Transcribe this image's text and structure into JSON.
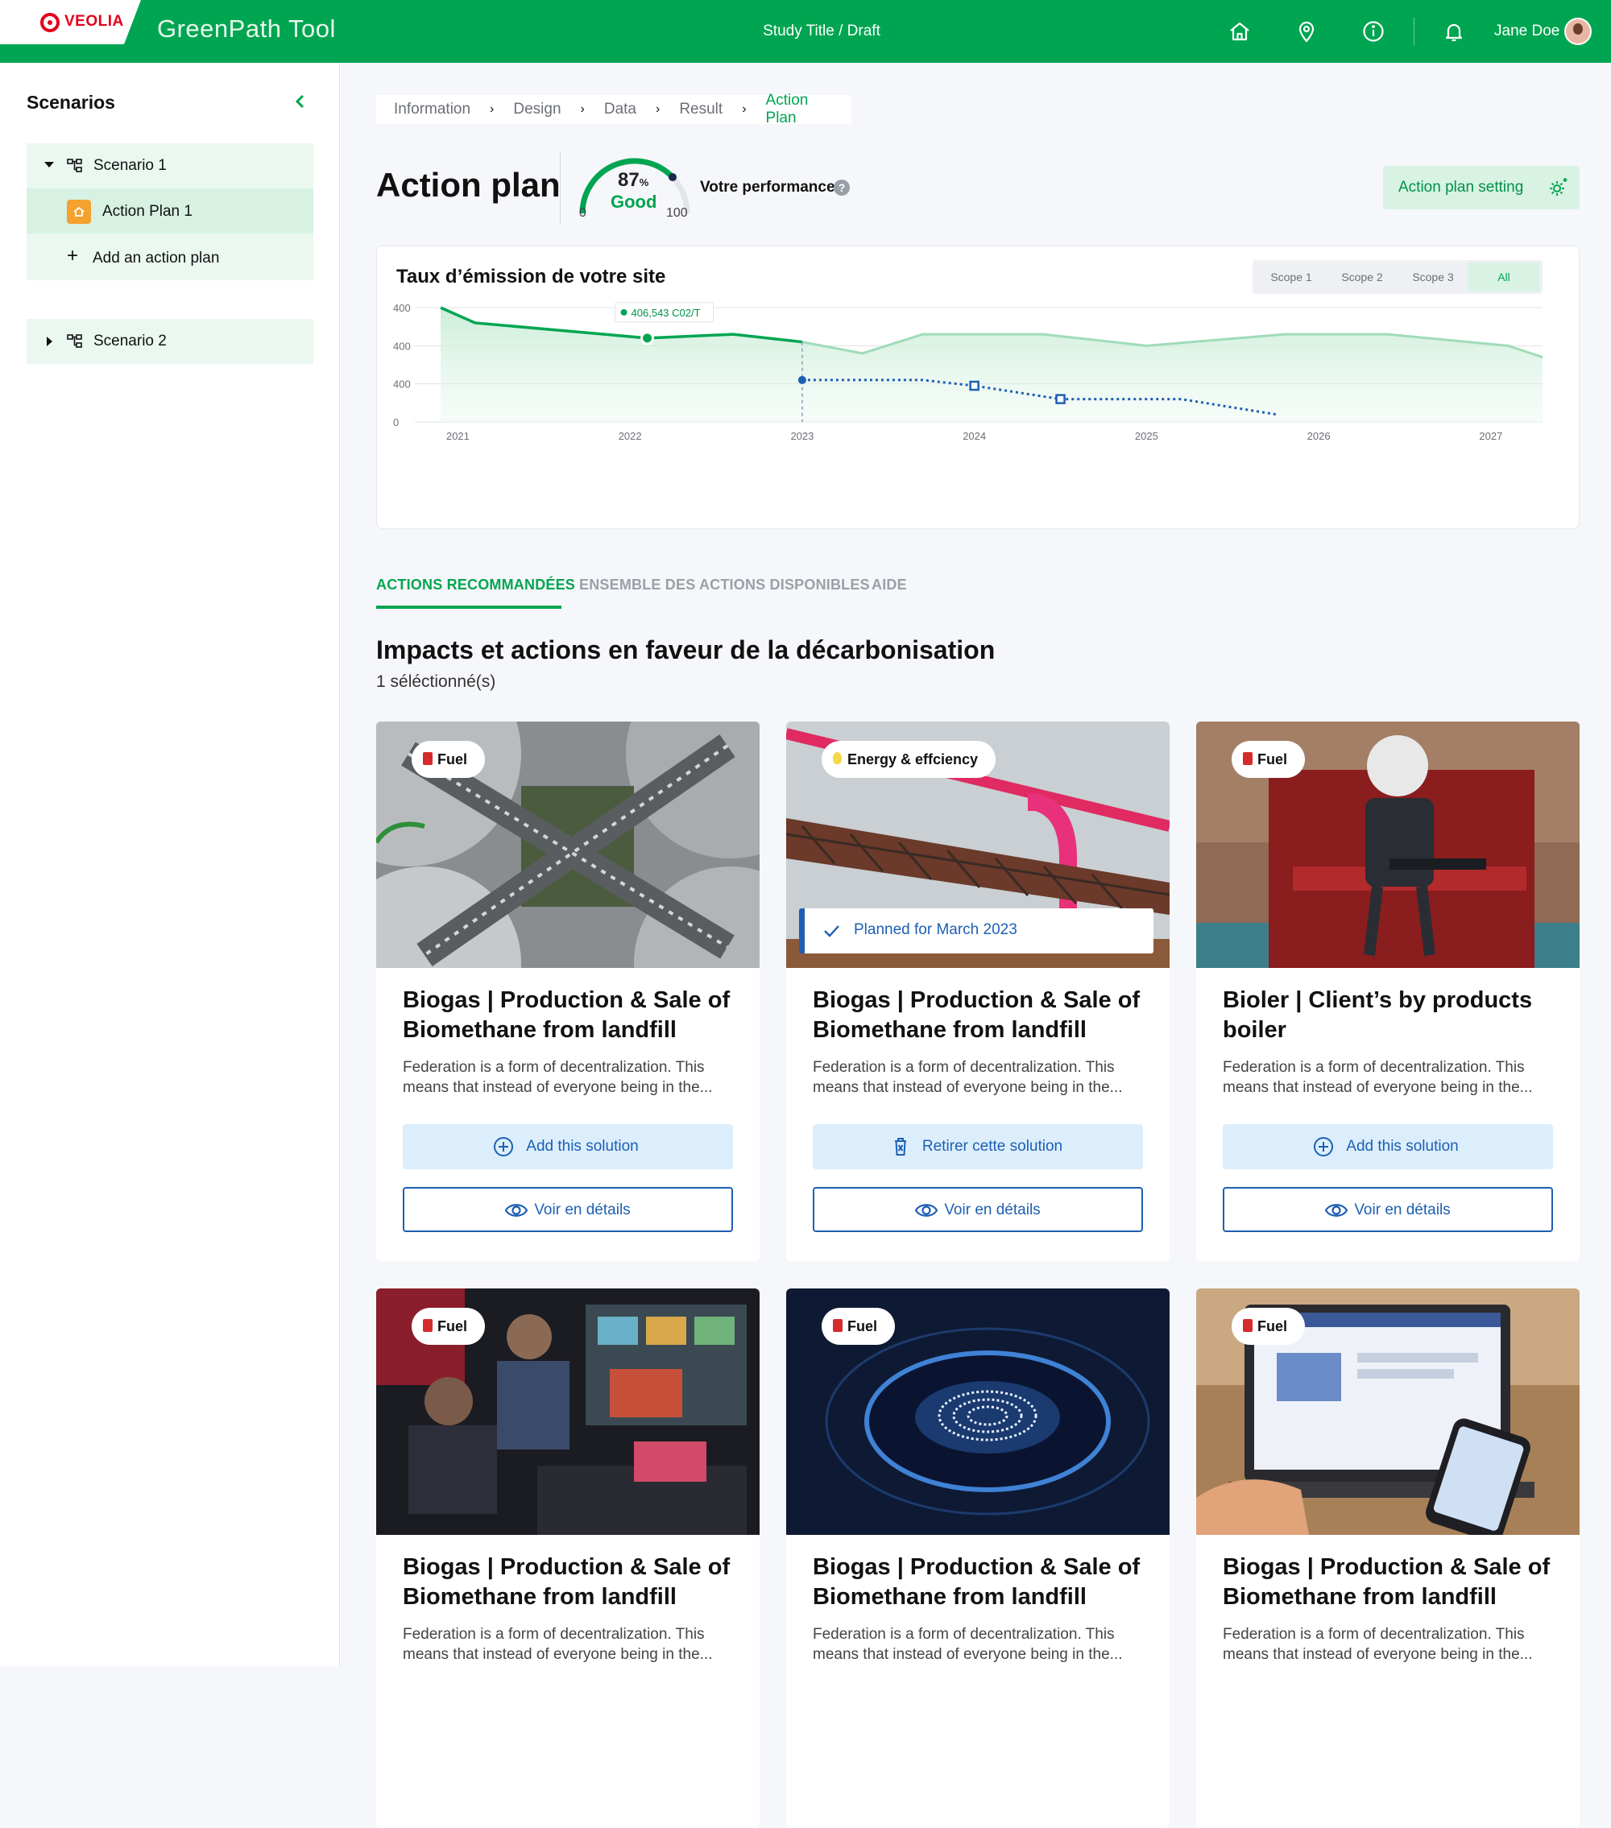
{
  "header": {
    "logo_text": "VEOLIA",
    "app_title": "GreenPath Tool",
    "study_title": "Study Title / Draft",
    "user_name": "Jane Doe"
  },
  "sidebar": {
    "title": "Scenarios",
    "scenarios": [
      {
        "label": "Scenario 1",
        "expanded": true
      },
      {
        "label": "Scenario 2",
        "expanded": false
      }
    ],
    "action_plan": "Action Plan 1",
    "add_action": "Add an action plan"
  },
  "breadcrumb": [
    "Information",
    "Design",
    "Data",
    "Result",
    "Action Plan"
  ],
  "page": {
    "title": "Action plan",
    "gauge_value": "87",
    "gauge_unit": "%",
    "gauge_status": "Good",
    "gauge_min": "0",
    "gauge_max": "100",
    "perf_label": "Votre performance",
    "help_glyph": "?",
    "setting_button": "Action plan setting"
  },
  "chart": {
    "title": "Taux d’émission de votre site",
    "scopes": [
      "Scope 1",
      "Scope 2",
      "Scope 3",
      "All"
    ],
    "active_scope": "All",
    "tooltip": "406,543 C02/T"
  },
  "chart_data": {
    "type": "line",
    "title": "Taux d’émission de votre site",
    "xlabel": "",
    "ylabel": "",
    "x_ticks": [
      "2021",
      "2022",
      "2023",
      "2024",
      "2025",
      "2026",
      "2027"
    ],
    "y_ticks": [
      "0",
      "400",
      "400",
      "400"
    ],
    "series": [
      {
        "style": "actual",
        "x": [
          2020.9,
          2021.1,
          2022.1,
          2022.6,
          2023.0
        ],
        "y": [
          3.0,
          2.6,
          2.2,
          2.3,
          2.1
        ]
      },
      {
        "style": "projection",
        "x": [
          2023.0,
          2023.35,
          2023.7,
          2024.4,
          2025.0,
          2025.8,
          2026.4,
          2027.1,
          2027.3
        ],
        "y": [
          2.1,
          1.8,
          2.3,
          2.3,
          2.0,
          2.3,
          2.3,
          2.0,
          1.7
        ]
      },
      {
        "style": "plan",
        "x": [
          2023.0,
          2023.7,
          2024.0,
          2024.5,
          2025.2,
          2025.75
        ],
        "y": [
          1.1,
          1.1,
          0.95,
          0.6,
          0.6,
          0.2
        ]
      }
    ],
    "grid": true,
    "legend": "none"
  },
  "tabs": [
    "ACTIONS RECOMMANDÉES",
    "ENSEMBLE DES ACTIONS DISPONIBLES",
    "AIDE"
  ],
  "section": {
    "title": "Impacts et actions en faveur de la décarbonisation",
    "subtitle": "1 séléctionné(s)"
  },
  "cards": [
    {
      "badge": "Fuel",
      "badge_icon": "fuel-icon",
      "title": "Biogas | Production & Sale of Biomethane from landfill",
      "desc": "Federation is a form of decentralization. This means that instead of everyone being in the...",
      "action": "Add this solution",
      "action_type": "add",
      "details": "Voir en détails",
      "planned": ""
    },
    {
      "badge": "Energy & effciency",
      "badge_icon": "bulb-icon",
      "title": "Biogas | Production & Sale of Biomethane from landfill",
      "desc": "Federation is a form of decentralization. This means that instead of everyone being in the...",
      "action": "Retirer cette solution",
      "action_type": "remove",
      "details": "Voir en détails",
      "planned": "Planned for March 2023"
    },
    {
      "badge": "Fuel",
      "badge_icon": "fuel-icon",
      "title": "Bioler | Client’s by products boiler",
      "desc": "Federation is a form of decentralization. This means that instead of everyone being in the...",
      "action": "Add this solution",
      "action_type": "add",
      "details": "Voir en détails",
      "planned": ""
    },
    {
      "badge": "Fuel",
      "badge_icon": "fuel-icon",
      "title": "Biogas | Production & Sale of Biomethane from landfill",
      "desc": "Federation is a form of decentralization. This means that instead of everyone being in the...",
      "action": "",
      "action_type": "add",
      "details": "",
      "planned": ""
    },
    {
      "badge": "Fuel",
      "badge_icon": "fuel-icon",
      "title": "Biogas | Production & Sale of Biomethane from landfill",
      "desc": "Federation is a form of decentralization. This means that instead of everyone being in the...",
      "action": "",
      "action_type": "add",
      "details": "",
      "planned": ""
    },
    {
      "badge": "Fuel",
      "badge_icon": "fuel-icon",
      "title": "Biogas | Production & Sale of Biomethane from landfill",
      "desc": "Federation is a form of decentralization. This means that instead of everyone being in the...",
      "action": "",
      "action_type": "add",
      "details": "",
      "planned": ""
    }
  ],
  "colors": {
    "brand_green": "#00a551",
    "action_blue": "#1d5fb3",
    "veolia_red": "#e2001a"
  }
}
